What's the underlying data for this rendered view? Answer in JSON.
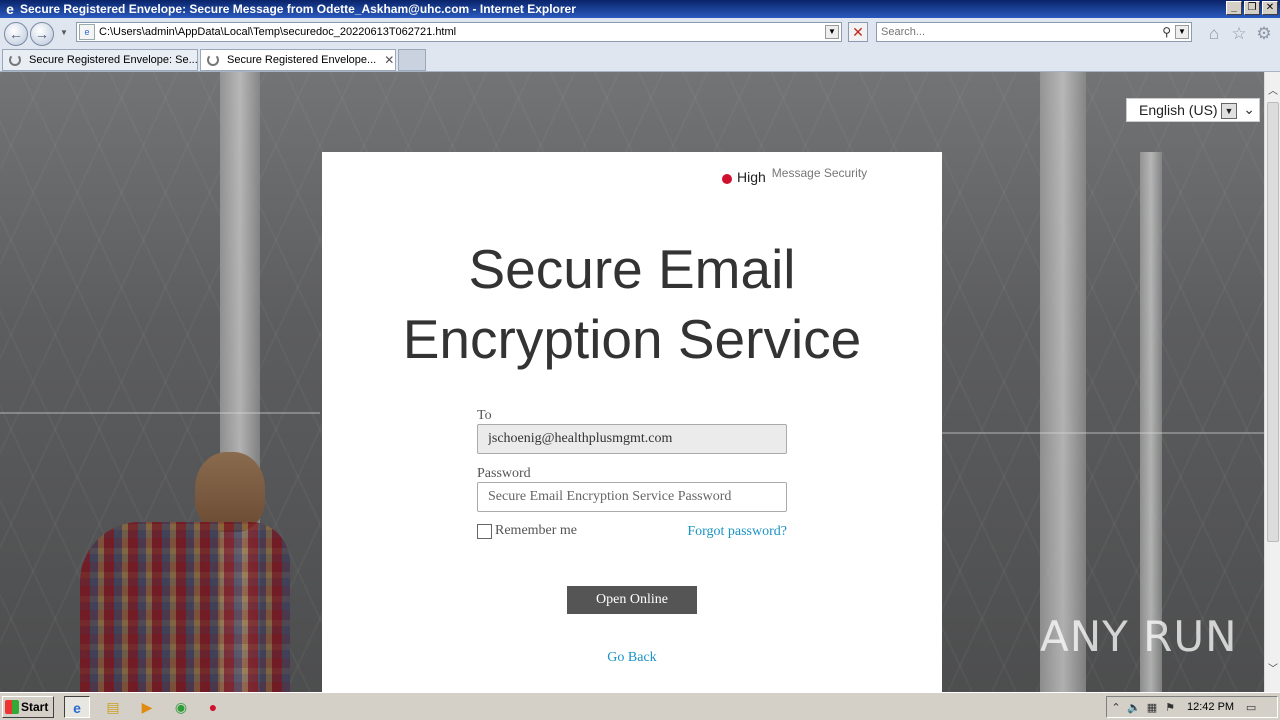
{
  "window": {
    "title": "Secure Registered Envelope: Secure Message from Odette_Askham@uhc.com - Internet Explorer",
    "buttons": [
      "minimize",
      "restore",
      "close"
    ]
  },
  "browser": {
    "address": "C:\\Users\\admin\\AppData\\Local\\Temp\\securedoc_20220613T062721.html",
    "search_placeholder": "Search...",
    "tabs": [
      {
        "label": "Secure Registered Envelope: Se...",
        "active": false
      },
      {
        "label": "Secure Registered Envelope...",
        "active": true
      }
    ]
  },
  "page": {
    "language": "English (US)",
    "security_level": "High",
    "security_label": "Message Security",
    "headline_line1": "Secure Email",
    "headline_line2": "Encryption Service",
    "to_label": "To",
    "to_value": "jschoenig@healthplusmgmt.com",
    "password_label": "Password",
    "password_placeholder": "Secure Email Encryption Service Password",
    "remember_label": "Remember me",
    "forgot_label": "Forgot password?",
    "open_button": "Open Online",
    "go_back": "Go Back",
    "watermark": "ANY RUN"
  },
  "taskbar": {
    "start_label": "Start",
    "clock": "12:42 PM"
  },
  "colors": {
    "link": "#1993c4",
    "security_dot": "#d0102d",
    "button_bg": "#555555"
  }
}
